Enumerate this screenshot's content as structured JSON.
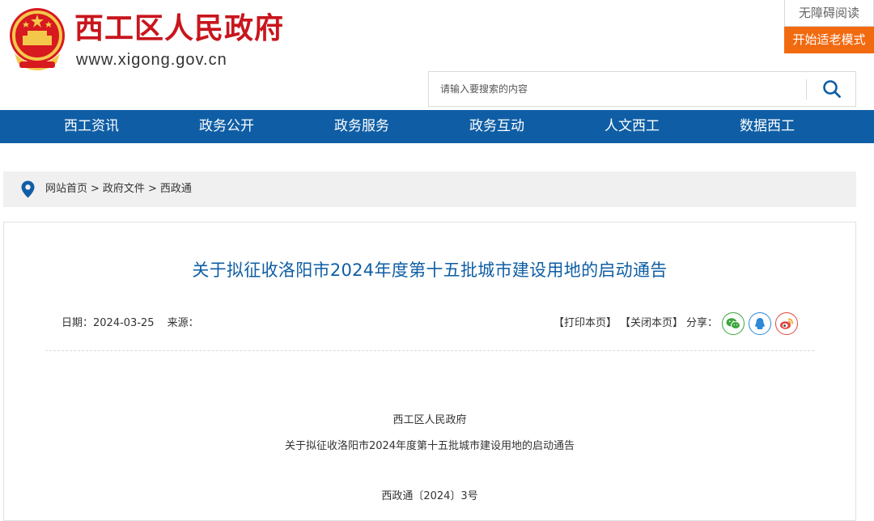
{
  "header": {
    "site_title": "西工区人民政府",
    "site_url": "www.xigong.gov.cn",
    "accessibility_label": "无障碍阅读",
    "elder_mode_label": "开始适老模式"
  },
  "search": {
    "placeholder": "请输入要搜索的内容"
  },
  "nav": {
    "items": [
      "西工资讯",
      "政务公开",
      "政务服务",
      "政务互动",
      "人文西工",
      "数据西工"
    ]
  },
  "breadcrumb": {
    "home": "网站首页",
    "level2": "政府文件",
    "level3": "西政通",
    "separator": ">"
  },
  "article": {
    "title": "关于拟征收洛阳市2024年度第十五批城市建设用地的启动通告",
    "date_label": "日期：2024-03-25",
    "source_label": "来源：",
    "print_label": "【打印本页】",
    "close_label": "【关闭本页】",
    "share_label": "分享：",
    "issuer": "西工区人民政府",
    "doc_title": "关于拟征收洛阳市2024年度第十五批城市建设用地的启动通告",
    "doc_number": "西政通〔2024〕3号"
  },
  "colors": {
    "brand_red": "#c8161d",
    "nav_blue": "#0f5ea5",
    "elder_orange": "#f26a10",
    "wechat_green": "#3aa53a",
    "qq_blue": "#2d8ad6",
    "weibo_red": "#e2463f"
  },
  "icons": {
    "emblem": "national-emblem-icon",
    "search": "search-icon",
    "location": "location-pin-icon",
    "share": [
      "wechat-icon",
      "qq-icon",
      "weibo-icon"
    ]
  }
}
